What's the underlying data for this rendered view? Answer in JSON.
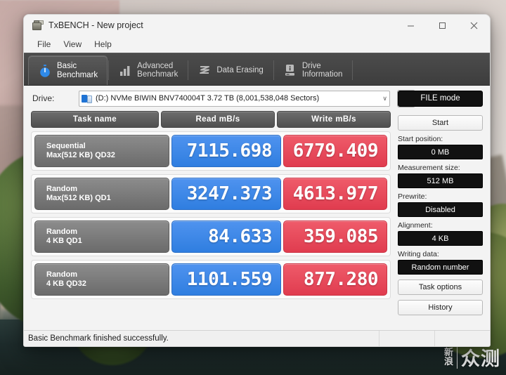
{
  "window": {
    "title": "TxBENCH - New project",
    "icon": "app-icon",
    "controls": {
      "minimize": "–",
      "maximize": "□",
      "close": "×"
    }
  },
  "menu": {
    "items": [
      "File",
      "View",
      "Help"
    ]
  },
  "tabs": [
    {
      "line1": "Basic",
      "line2": "Benchmark",
      "icon": "stopwatch-icon",
      "active": true
    },
    {
      "line1": "Advanced",
      "line2": "Benchmark",
      "icon": "bar-chart-icon",
      "active": false
    },
    {
      "line1": "Data Erasing",
      "line2": "",
      "icon": "eraser-icon",
      "active": false
    },
    {
      "line1": "Drive",
      "line2": "Information",
      "icon": "drive-info-icon",
      "active": false
    }
  ],
  "drive": {
    "label": "Drive:",
    "selected": "(D:) NVMe BIWIN BNV740004T  3.72 TB (8,001,538,048 Sectors)",
    "caret": "∨",
    "refresh_icon": "refresh-icon"
  },
  "results": {
    "headers": [
      "Task name",
      "Read mB/s",
      "Write mB/s"
    ],
    "rows": [
      {
        "name_line1": "Sequential",
        "name_line2": "Max(512 KB) QD32",
        "read": "7115.698",
        "write": "6779.409"
      },
      {
        "name_line1": "Random",
        "name_line2": "Max(512 KB) QD1",
        "read": "3247.373",
        "write": "4613.977"
      },
      {
        "name_line1": "Random",
        "name_line2": "4 KB QD1",
        "read": "84.633",
        "write": "359.085"
      },
      {
        "name_line1": "Random",
        "name_line2": "4 KB QD32",
        "read": "1101.559",
        "write": "877.280"
      }
    ]
  },
  "sidepanel": {
    "file_mode": "FILE mode",
    "start": "Start",
    "start_position_label": "Start position:",
    "start_position_value": "0 MB",
    "measurement_size_label": "Measurement size:",
    "measurement_size_value": "512 MB",
    "prewrite_label": "Prewrite:",
    "prewrite_value": "Disabled",
    "alignment_label": "Alignment:",
    "alignment_value": "4 KB",
    "writing_data_label": "Writing data:",
    "writing_data_value": "Random number",
    "task_options": "Task options",
    "history": "History"
  },
  "statusbar": {
    "message": "Basic Benchmark finished successfully."
  },
  "watermark": {
    "small_line1": "新",
    "small_line2": "浪",
    "big": "众测"
  },
  "colors": {
    "read_blue": "#2f7ee0",
    "write_red": "#e03c4f",
    "tab_active_bg": "#4f4f4f",
    "value_box_text": "#ffffff",
    "accent_icon_blue": "#2f8ae8"
  }
}
